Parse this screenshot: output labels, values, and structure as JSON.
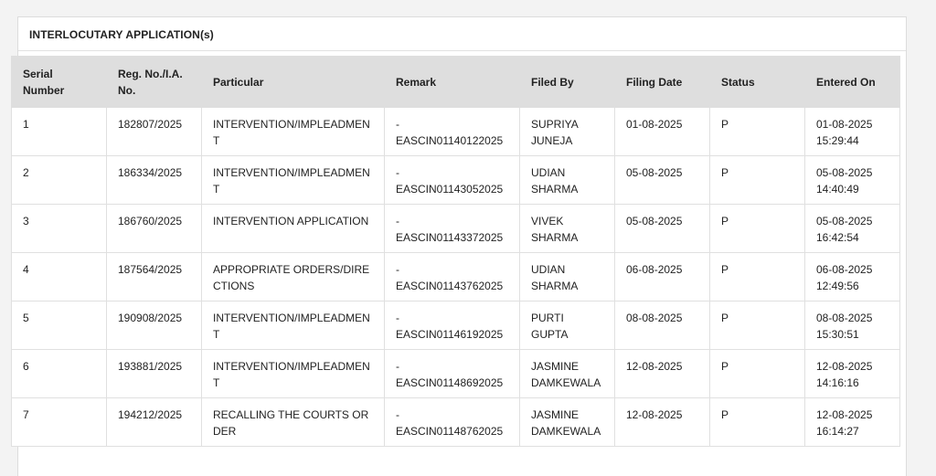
{
  "section": {
    "title": "INTERLOCUTARY APPLICATION(s)"
  },
  "table": {
    "headers": {
      "serial": "Serial Number",
      "reg": "Reg. No./I.A. No.",
      "particular": "Particular",
      "remark": "Remark",
      "filed_by": "Filed By",
      "filing_date": "Filing Date",
      "status": "Status",
      "entered_on": "Entered On"
    },
    "rows": [
      {
        "serial": "1",
        "reg": "182807/2025",
        "particular": "INTERVENTION/IMPLEADMENT",
        "remark_dash": "-",
        "remark": "EASCIN01140122025",
        "filed_by": "SUPRIYA JUNEJA",
        "filing_date": "01-08-2025",
        "status": "P",
        "entered_date": "01-08-2025",
        "entered_time": "15:29:44"
      },
      {
        "serial": "2",
        "reg": "186334/2025",
        "particular": "INTERVENTION/IMPLEADMENT",
        "remark_dash": "-",
        "remark": "EASCIN01143052025",
        "filed_by": "UDIAN SHARMA",
        "filing_date": "05-08-2025",
        "status": "P",
        "entered_date": "05-08-2025",
        "entered_time": "14:40:49"
      },
      {
        "serial": "3",
        "reg": "186760/2025",
        "particular": "INTERVENTION APPLICATION",
        "remark_dash": "-",
        "remark": "EASCIN01143372025",
        "filed_by": "VIVEK SHARMA",
        "filing_date": "05-08-2025",
        "status": "P",
        "entered_date": "05-08-2025",
        "entered_time": "16:42:54"
      },
      {
        "serial": "4",
        "reg": "187564/2025",
        "particular": "APPROPRIATE ORDERS/DIRECTIONS",
        "remark_dash": "-",
        "remark": "EASCIN01143762025",
        "filed_by": "UDIAN SHARMA",
        "filing_date": "06-08-2025",
        "status": "P",
        "entered_date": "06-08-2025",
        "entered_time": "12:49:56"
      },
      {
        "serial": "5",
        "reg": "190908/2025",
        "particular": "INTERVENTION/IMPLEADMENT",
        "remark_dash": "-",
        "remark": "EASCIN01146192025",
        "filed_by": "PURTI GUPTA",
        "filing_date": "08-08-2025",
        "status": "P",
        "entered_date": "08-08-2025",
        "entered_time": "15:30:51"
      },
      {
        "serial": "6",
        "reg": "193881/2025",
        "particular": "INTERVENTION/IMPLEADMENT",
        "remark_dash": "-",
        "remark": "EASCIN01148692025",
        "filed_by": "JASMINE DAMKEWALA",
        "filing_date": "12-08-2025",
        "status": "P",
        "entered_date": "12-08-2025",
        "entered_time": "14:16:16"
      },
      {
        "serial": "7",
        "reg": "194212/2025",
        "particular": "RECALLING THE COURTS ORDER",
        "remark_dash": "-",
        "remark": "EASCIN01148762025",
        "filed_by": "JASMINE DAMKEWALA",
        "filing_date": "12-08-2025",
        "status": "P",
        "entered_date": "12-08-2025",
        "entered_time": "16:14:27"
      }
    ]
  }
}
